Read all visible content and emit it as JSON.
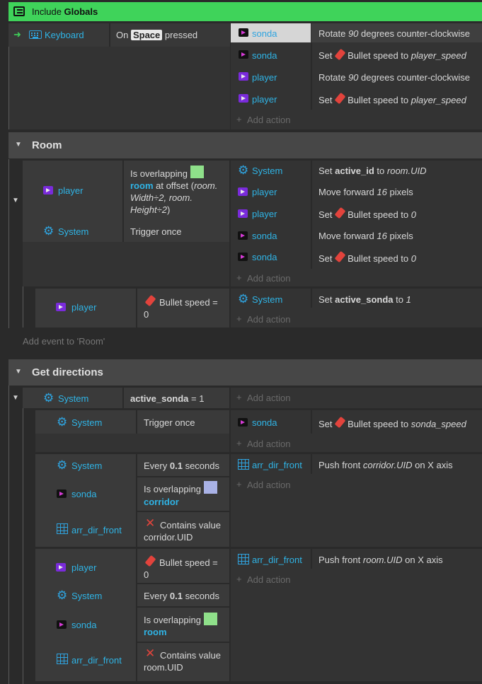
{
  "include": {
    "prefix": "Include",
    "name": "Globals"
  },
  "ev1": {
    "cond_object": "Keyboard",
    "cond_on": "On",
    "cond_key": "Space",
    "cond_pressed": "pressed",
    "actions": [
      {
        "object": "sonda",
        "pre": "Rotate",
        "num": "90",
        "post": "degrees counter-clockwise"
      },
      {
        "object": "sonda",
        "pre": "Set",
        "mid": "Bullet speed to",
        "val": "player_speed"
      },
      {
        "object": "player",
        "pre": "Rotate",
        "num": "90",
        "post": "degrees counter-clockwise"
      },
      {
        "object": "player",
        "pre": "Set",
        "mid": "Bullet speed to",
        "val": "player_speed"
      }
    ]
  },
  "add_action": "Add action",
  "room": {
    "title": "Room",
    "cond1_object": "player",
    "cond1_is": "Is overlapping",
    "cond1_target": "room",
    "cond1_atoffset": "at offset (",
    "cond1_line2": "room.",
    "cond1_line3": "Width÷2, room.",
    "cond1_line4": "Height÷2",
    "cond1_close": ")",
    "cond2_object": "System",
    "cond2_text": "Trigger once",
    "actions": [
      {
        "object": "System",
        "pre": "Set",
        "var": "active_id",
        "to": "to",
        "val": "room.UID"
      },
      {
        "object": "player",
        "pre": "Move forward",
        "num": "16",
        "post": "pixels"
      },
      {
        "object": "player",
        "pre": "Set",
        "mid": "Bullet speed to",
        "val": "0"
      },
      {
        "object": "sonda",
        "pre": "Move forward",
        "num": "16",
        "post": "pixels"
      },
      {
        "object": "sonda",
        "pre": "Set",
        "mid": "Bullet speed to",
        "val": "0"
      }
    ],
    "sub": {
      "cond_object": "player",
      "cond_text": "Bullet speed =",
      "cond_val": "0",
      "act_object": "System",
      "act_pre": "Set",
      "act_var": "active_sonda",
      "act_to": "to",
      "act_val": "1"
    },
    "add_event": "Add event to 'Room'"
  },
  "dirs": {
    "title": "Get directions",
    "top_cond_object": "System",
    "top_cond_var": "active_sonda",
    "top_cond_eq": "= 1",
    "s1": {
      "cond_object": "System",
      "cond_text": "Trigger once",
      "act_object": "sonda",
      "act_pre": "Set",
      "act_mid": "Bullet speed to",
      "act_val": "sonda_speed"
    },
    "s2": {
      "c1_object": "System",
      "c1_pre": "Every",
      "c1_num": "0.1",
      "c1_post": "seconds",
      "c2_object": "sonda",
      "c2_text": "Is overlapping",
      "c2_target": "corridor",
      "c3_object": "arr_dir_front",
      "c3_text": "Contains value",
      "c3_val": "corridor.UID",
      "act_object": "arr_dir_front",
      "act_pre": "Push front",
      "act_val": "corridor.UID",
      "act_post": "on X axis"
    },
    "s3": {
      "c1_object": "player",
      "c1_text": "Bullet speed =",
      "c1_val": "0",
      "c2_object": "System",
      "c2_pre": "Every",
      "c2_num": "0.1",
      "c2_post": "seconds",
      "c3_object": "sonda",
      "c3_text": "Is overlapping",
      "c3_target": "room",
      "c4_object": "arr_dir_front",
      "c4_text": "Contains value",
      "c4_val": "room.UID",
      "act_object": "arr_dir_front",
      "act_pre": "Push front",
      "act_val": "room.UID",
      "act_post": "on X axis"
    }
  },
  "colors": {
    "include_green": "#3fd35a",
    "swatch_green": "#8fe08a",
    "swatch_blue": "#a9b2e6",
    "object_blue": "#2fb4e6"
  }
}
